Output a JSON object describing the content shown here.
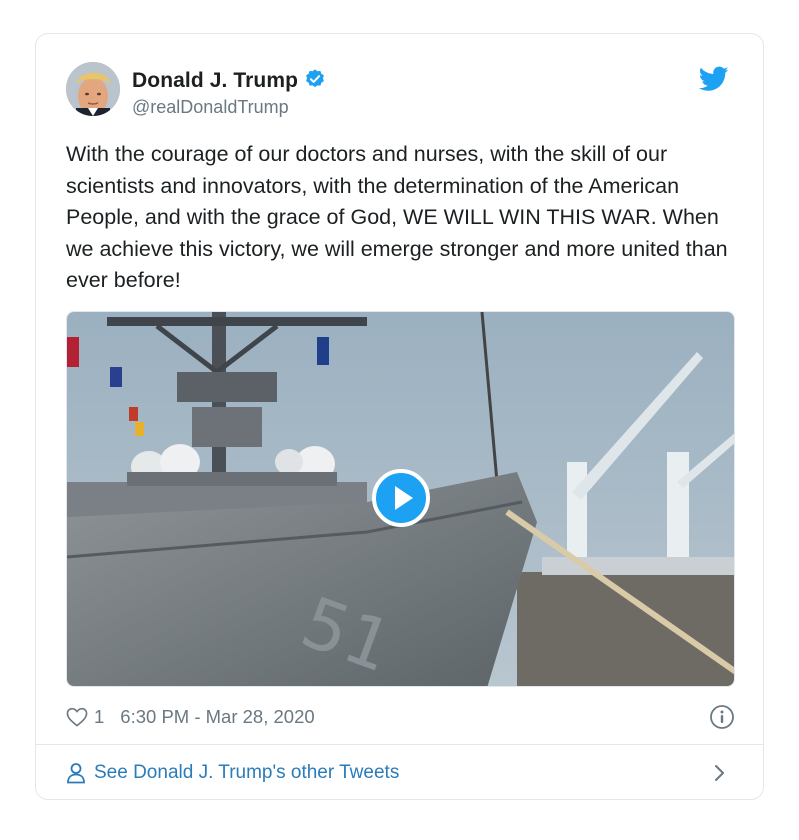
{
  "tweet": {
    "author": {
      "display_name": "Donald J. Trump",
      "handle": "@realDonaldTrump",
      "verified": true
    },
    "text": "With the courage of our doctors and nurses, with the skill of our scientists and innovators, with the determination of the American People, and with the grace of God, WE WILL WIN THIS WAR. When we achieve this victory, we will emerge stronger and more united than ever before!",
    "likes": "1",
    "timestamp": "6:30 PM - Mar 28, 2020",
    "footer_link": "See Donald J. Trump's other Tweets"
  },
  "icons": {
    "brand": "twitter-bird-icon",
    "verified": "verified-badge-icon",
    "play": "play-icon",
    "like": "heart-icon",
    "info": "info-icon",
    "person": "person-icon",
    "chevron": "chevron-right-icon"
  },
  "colors": {
    "twitter_blue": "#1da1f2",
    "link_blue": "#2b7bb9",
    "meta_gray": "#697882",
    "text": "#1c2022",
    "border": "#e1e8ed"
  }
}
